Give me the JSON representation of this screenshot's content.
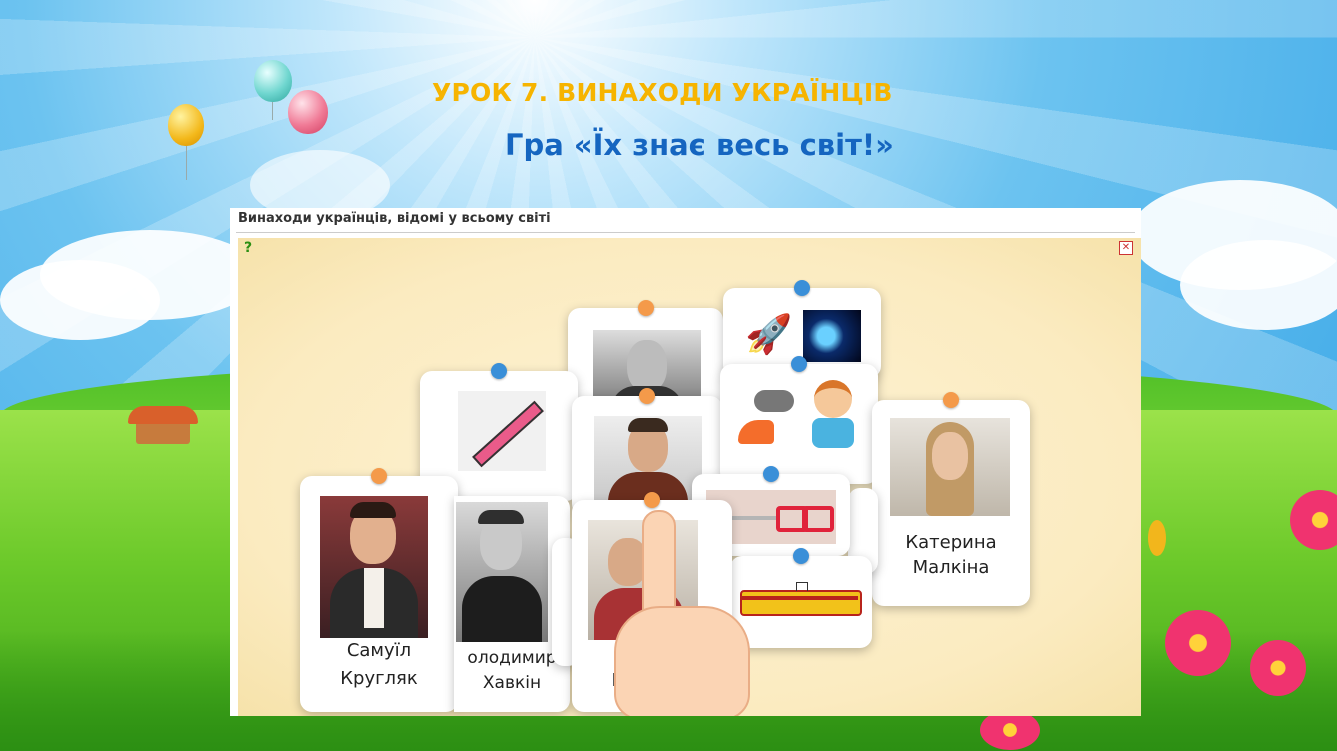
{
  "slide": {
    "title": "УРОК 7. ВИНАХОДИ УКРАЇНЦІВ",
    "subtitle": "Гра «Їх знає весь світ!»"
  },
  "frame": {
    "title": "Винаходи українців, відомі у всьому світі"
  },
  "cards": [
    {
      "label_line1": "Самуїл",
      "label_line2": "Кругляк"
    },
    {
      "label_line1": "олодимир",
      "label_line2": "Хавкін"
    },
    {
      "label_line1": "Ши",
      "label_line2": ""
    },
    {
      "label_line1": "Катерина",
      "label_line2": "Малкіна"
    }
  ],
  "colors": {
    "title": "#f6b400",
    "subtitle": "#1565c0",
    "pin_orange": "#f49a4a",
    "pin_blue": "#3a8fd8"
  },
  "icons": {
    "help": "help-question-icon",
    "close": "close-fullscreen-icon"
  }
}
